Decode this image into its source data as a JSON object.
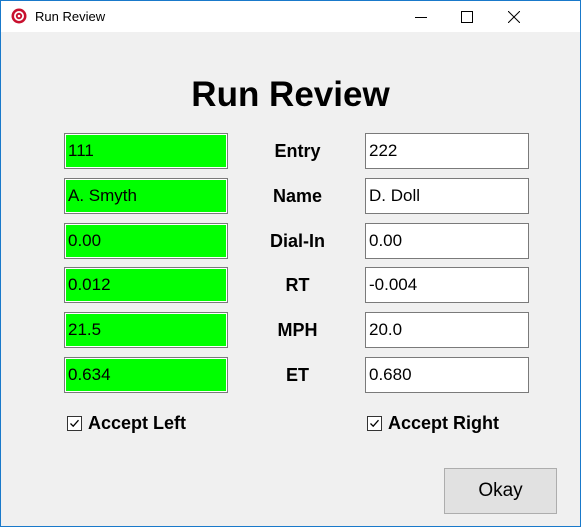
{
  "window": {
    "title": "Run Review",
    "icon": "app-record-icon"
  },
  "heading": "Run Review",
  "rows": [
    {
      "label": "Entry",
      "left": "111",
      "right": "222"
    },
    {
      "label": "Name",
      "left": "A. Smyth",
      "right": "D. Doll"
    },
    {
      "label": "Dial-In",
      "left": "0.00",
      "right": "0.00"
    },
    {
      "label": "RT",
      "left": "0.012",
      "right": "-0.004"
    },
    {
      "label": "MPH",
      "left": "21.5",
      "right": "20.0"
    },
    {
      "label": "ET",
      "left": "0.634",
      "right": "0.680"
    }
  ],
  "accept_left": {
    "label": "Accept Left",
    "checked": true
  },
  "accept_right": {
    "label": "Accept Right",
    "checked": true
  },
  "okay_label": "Okay",
  "colors": {
    "left_field_bg": "#00ff00",
    "window_border": "#1979ca",
    "dialog_bg": "#f0f0f0"
  }
}
